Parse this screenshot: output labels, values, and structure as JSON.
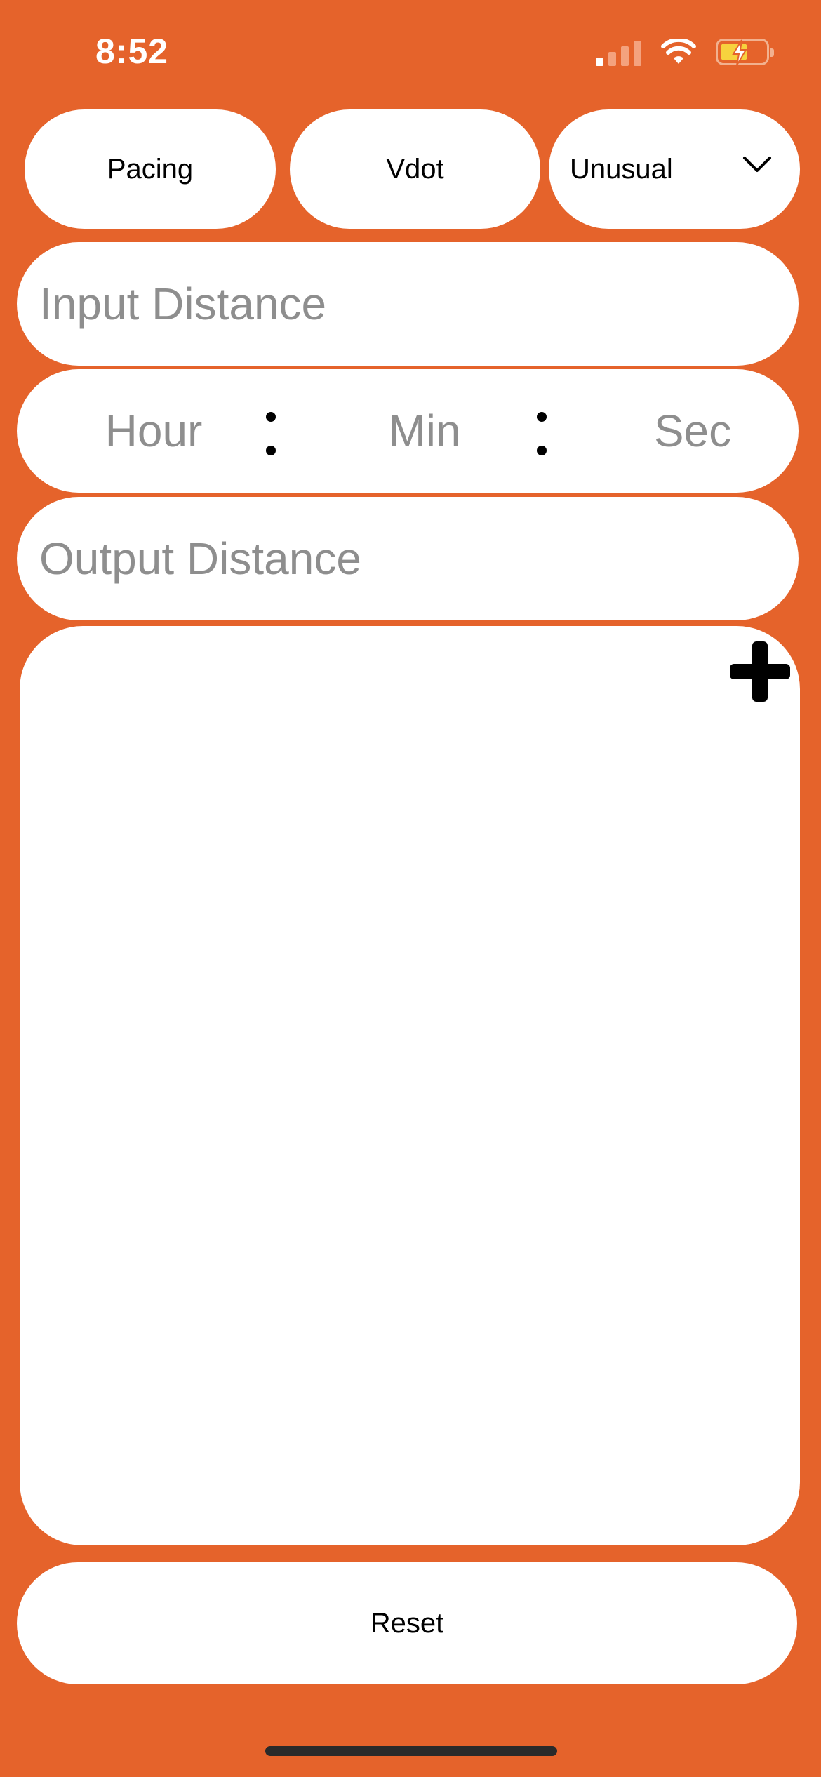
{
  "status_bar": {
    "time": "8:52",
    "icons": [
      "cellular-signal-icon",
      "wifi-icon",
      "battery-charging-icon"
    ]
  },
  "tabs": {
    "pacing": "Pacing",
    "vdot": "Vdot",
    "unusual": "Unusual"
  },
  "inputs": {
    "input_distance_placeholder": "Input Distance",
    "hour_placeholder": "Hour",
    "min_placeholder": "Min",
    "sec_placeholder": "Sec",
    "output_distance_placeholder": "Output Distance"
  },
  "actions": {
    "add_icon": "plus-icon",
    "reset_label": "Reset"
  },
  "colors": {
    "background": "#E5632B",
    "surface": "#FFFFFF",
    "placeholder": "#8E8E8E"
  }
}
